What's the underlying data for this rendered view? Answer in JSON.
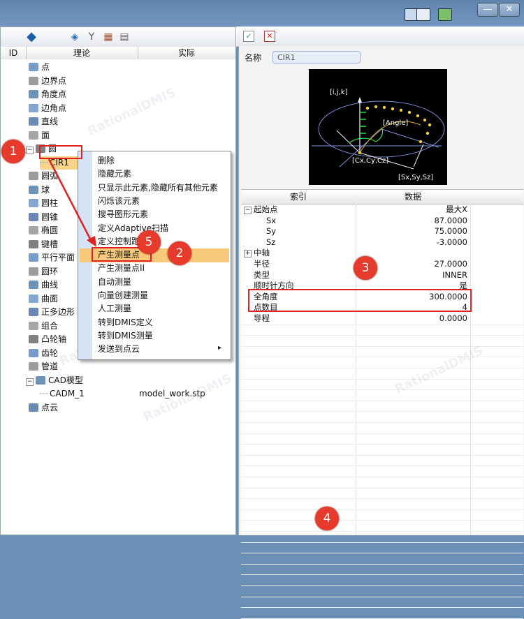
{
  "left_header": {
    "col_id": "ID",
    "col_theory": "理论",
    "col_actual": "实际"
  },
  "tree": [
    {
      "label": "点",
      "icon": "point-icon",
      "indent": 1
    },
    {
      "label": "边界点",
      "icon": "edge-point-icon",
      "indent": 1
    },
    {
      "label": "角度点",
      "icon": "angle-point-icon",
      "indent": 1
    },
    {
      "label": "边角点",
      "icon": "corner-point-icon",
      "indent": 1
    },
    {
      "label": "直线",
      "icon": "line-icon",
      "indent": 1
    },
    {
      "label": "面",
      "icon": "plane-icon",
      "indent": 1
    },
    {
      "label": "圆",
      "icon": "circle-icon",
      "indent": 0,
      "expander": "⊟"
    },
    {
      "label": "CIR1",
      "icon": "",
      "indent": 2
    },
    {
      "label": "圆弧",
      "icon": "arc-icon",
      "indent": 1
    },
    {
      "label": "球",
      "icon": "sphere-icon",
      "indent": 1
    },
    {
      "label": "圆柱",
      "icon": "cylinder-icon",
      "indent": 1
    },
    {
      "label": "圆锥",
      "icon": "cone-icon",
      "indent": 1
    },
    {
      "label": "椭圆",
      "icon": "ellipse-icon",
      "indent": 1
    },
    {
      "label": "键槽",
      "icon": "slot-icon",
      "indent": 1
    },
    {
      "label": "平行平面",
      "icon": "parallel-plane-icon",
      "indent": 1
    },
    {
      "label": "圆环",
      "icon": "torus-icon",
      "indent": 1
    },
    {
      "label": "曲线",
      "icon": "curve-icon",
      "indent": 1
    },
    {
      "label": "曲面",
      "icon": "surface-icon",
      "indent": 1
    },
    {
      "label": "正多边形",
      "icon": "polygon-icon",
      "indent": 1
    },
    {
      "label": "组合",
      "icon": "combine-icon",
      "indent": 1
    },
    {
      "label": "凸轮轴",
      "icon": "camshaft-icon",
      "indent": 1
    },
    {
      "label": "齿轮",
      "icon": "gear-icon",
      "indent": 1
    },
    {
      "label": "管道",
      "icon": "pipe-icon",
      "indent": 1
    },
    {
      "label": "CAD模型",
      "icon": "cad-icon",
      "indent": 0,
      "expander": "⊟"
    },
    {
      "label": "CADM_1",
      "icon": "",
      "indent": 2,
      "actual": "model_work.stp"
    },
    {
      "label": "点云",
      "icon": "point-cloud-icon",
      "indent": 1
    }
  ],
  "context_menu": [
    "删除",
    "隐藏元素",
    "只显示此元素,隐藏所有其他元素",
    "闪烁该元素",
    "搜寻图形元素",
    "定义Adaptive扫描",
    "定义控制跑",
    "产生测量点",
    "产生测量点II",
    "自动测量",
    "向量创建测量",
    "人工测量",
    "转到DMIS定义",
    "转到DMIS测量",
    "发送到点云"
  ],
  "menu_arrow": "▸",
  "right": {
    "name_label": "名称",
    "name_value": "CIR1",
    "diagram": {
      "ijk": "[i,j,k]",
      "angle": "[Angle]",
      "center": "[Cx,Cy,Cz]",
      "start": "[Sx,Sy,Sz]"
    },
    "grid_header": {
      "col_index": "索引",
      "col_data": "数据"
    },
    "grid_rows": [
      {
        "key": "起始点",
        "value": "最大X",
        "expander": "⊟",
        "level": 0
      },
      {
        "key": "Sx",
        "value": "87.0000",
        "level": 1
      },
      {
        "key": "Sy",
        "value": "75.0000",
        "level": 1
      },
      {
        "key": "Sz",
        "value": "-3.0000",
        "level": 1
      },
      {
        "key": "中轴",
        "value": "",
        "expander": "⊞",
        "level": 0
      },
      {
        "key": "半径",
        "value": "27.0000",
        "level": 0
      },
      {
        "key": "类型",
        "value": "INNER",
        "level": 0
      },
      {
        "key": "顺时针方向",
        "value": "是",
        "level": 0
      },
      {
        "key": "全角度",
        "value": "300.0000",
        "level": 0
      },
      {
        "key": "点数目",
        "value": "4",
        "level": 0
      },
      {
        "key": "导程",
        "value": "0.0000",
        "level": 0
      }
    ]
  },
  "badges": [
    "1",
    "2",
    "3",
    "4",
    "5"
  ],
  "watermark": "RationalDMIS",
  "colors": {
    "highlight": "#f7c97a",
    "badge": "#e53a2c",
    "accent": "#d22"
  }
}
